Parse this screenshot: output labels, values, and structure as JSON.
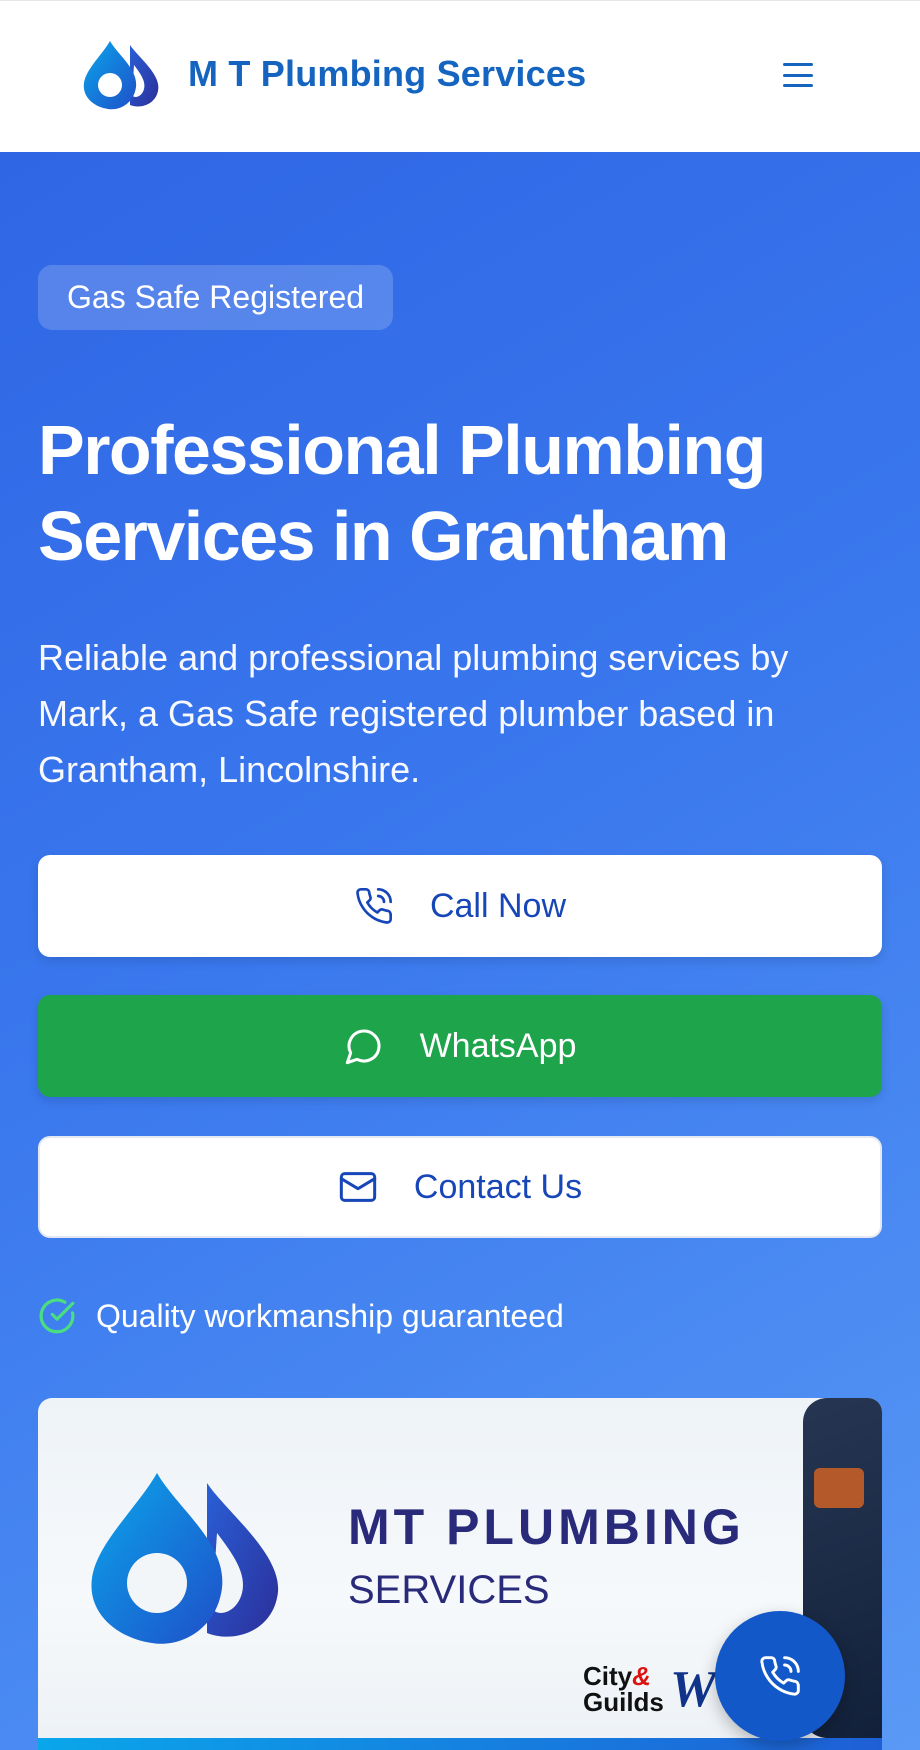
{
  "header": {
    "brand": "M T Plumbing Services",
    "logo_icon": "water-drops-logo",
    "menu_icon": "hamburger-menu-icon"
  },
  "hero": {
    "badge": "Gas Safe Registered",
    "title": "Professional Plumbing Services in Grantham",
    "description": "Reliable and professional plumbing services by Mark, a Gas Safe registered plumber based in Grantham, Lincolnshire.",
    "buttons": {
      "call": "Call Now",
      "whatsapp": "WhatsApp",
      "contact": "Contact Us"
    },
    "quality": "Quality workmanship guaranteed"
  },
  "banner": {
    "line1": "MT PLUMBING",
    "line2": "SERVICES",
    "cert1_a": "City",
    "cert1_amp": "&",
    "cert1_b": "Guilds",
    "cert2": "W"
  },
  "colors": {
    "brand_blue": "#1565c0",
    "hero_gradient_start": "#2f66e4",
    "hero_gradient_end": "#5a99f5",
    "whatsapp_green": "#1ea44b",
    "fab_blue": "#1358c8"
  }
}
